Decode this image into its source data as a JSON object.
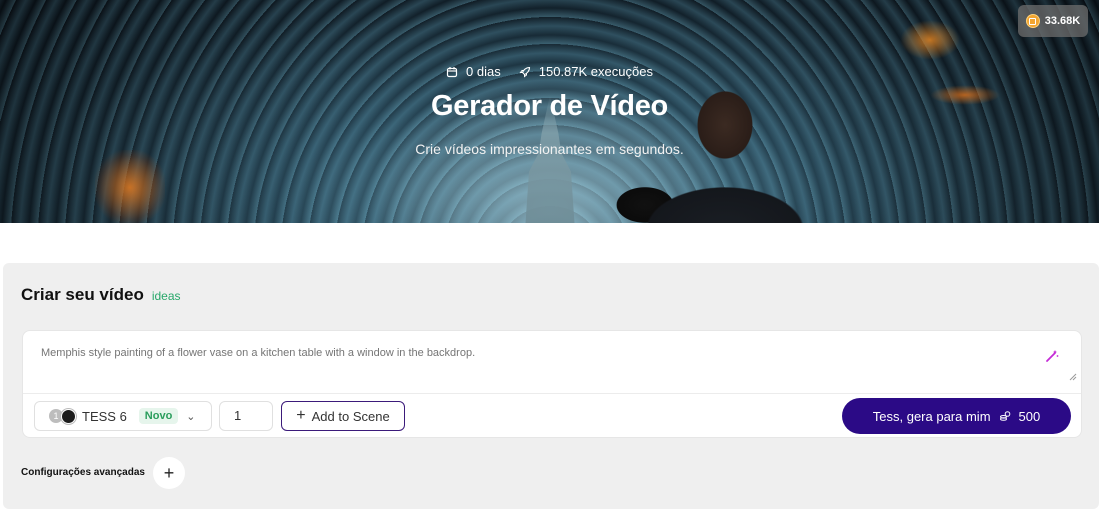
{
  "hero": {
    "days_label": "0 dias",
    "executions_label": "150.87K execuções",
    "title": "Gerador de Vídeo",
    "subtitle": "Crie vídeos impressionantes em segundos."
  },
  "credits": {
    "value": "33.68K",
    "icon": "coin-icon"
  },
  "panel": {
    "title": "Criar seu vídeo",
    "ideas_link": "ideas",
    "prompt_placeholder": "Memphis style painting of a flower vase on a kitchen table with a window in the backdrop.",
    "model": {
      "count": "1",
      "name": "TESS 6",
      "badge": "Novo"
    },
    "quantity": "1",
    "add_scene_label": "Add to Scene",
    "generate_label": "Tess, gera para mim",
    "generate_cost": "500",
    "advanced_label": "Configurações avançadas"
  },
  "colors": {
    "primary": "#2b0a86",
    "accent_green": "#27a86a",
    "panel_bg": "#efefef"
  }
}
